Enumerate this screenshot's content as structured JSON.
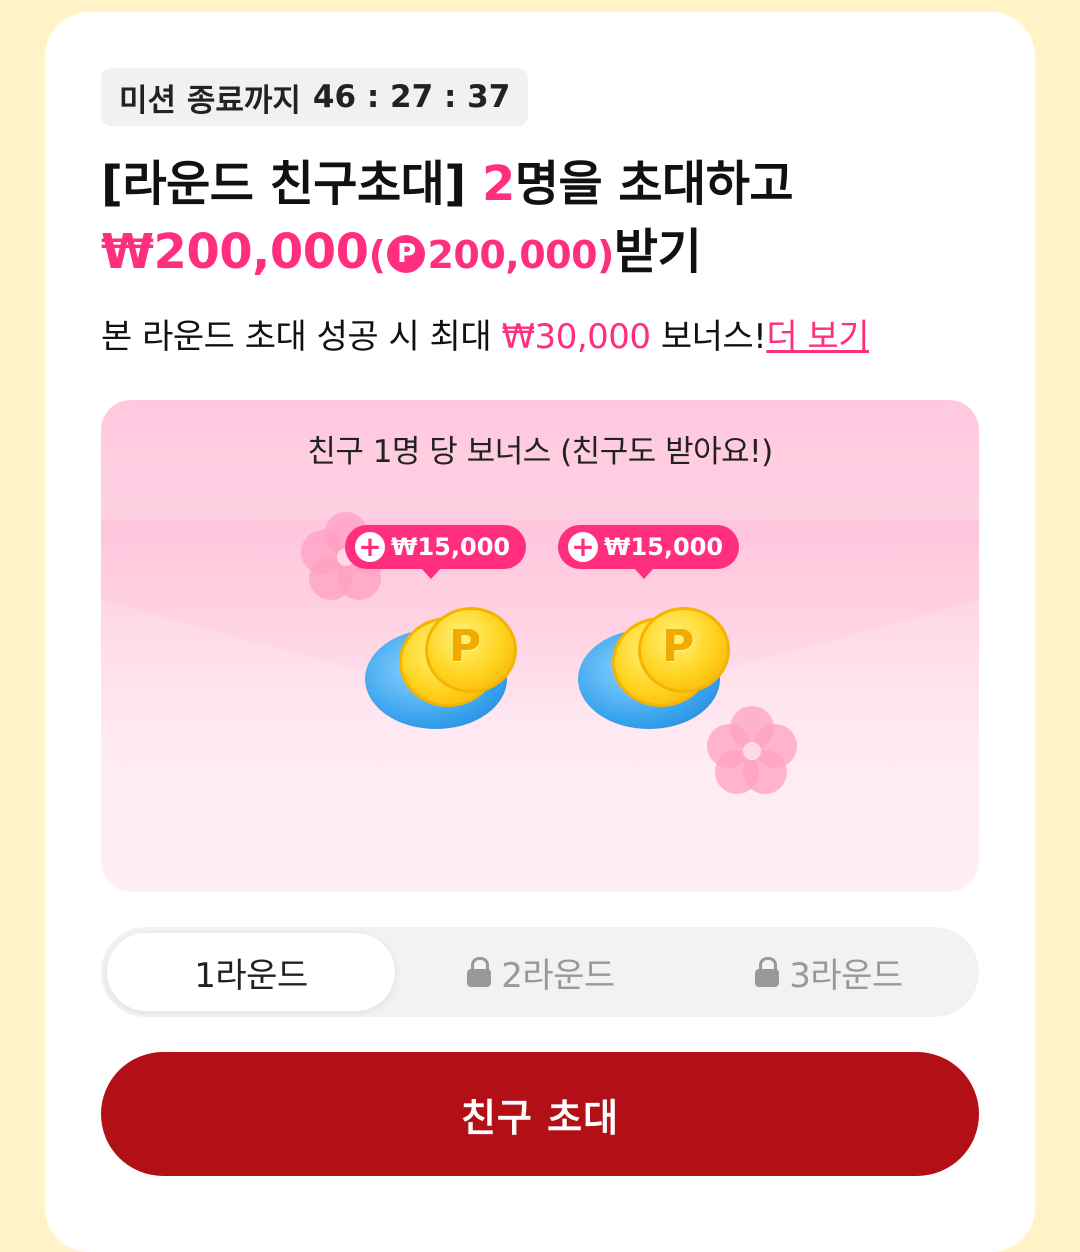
{
  "timer": {
    "label": "미션 종료까지",
    "value": "46 : 27 : 37"
  },
  "headline": {
    "prefix": "[라운드 친구초대]",
    "count": "2",
    "count_suffix": "명을 초대하고",
    "amount": "₩200,000",
    "paren_open": "(",
    "point_icon": "P",
    "point_amount": "200,000",
    "paren_close": ")",
    "suffix": "받기"
  },
  "subline": {
    "text": "본 라운드 초대 성공 시 최대",
    "amount": "₩30,000",
    "text2": "보너스!",
    "link": "더 보기"
  },
  "bonus": {
    "title": "친구 1명 당 보너스 (친구도 받아요!)",
    "rewards": [
      {
        "plus": "+",
        "amount": "₩15,000",
        "coin_letter": "P"
      },
      {
        "plus": "+",
        "amount": "₩15,000",
        "coin_letter": "P"
      }
    ]
  },
  "tabs": [
    {
      "label": "1라운드",
      "locked": false,
      "active": true
    },
    {
      "label": "2라운드",
      "locked": true,
      "active": false
    },
    {
      "label": "3라운드",
      "locked": true,
      "active": false
    }
  ],
  "cta": {
    "label": "친구 초대"
  },
  "colors": {
    "accent": "#FF2E7E",
    "cta": "#B30F16",
    "background": "#FFF3C7"
  }
}
